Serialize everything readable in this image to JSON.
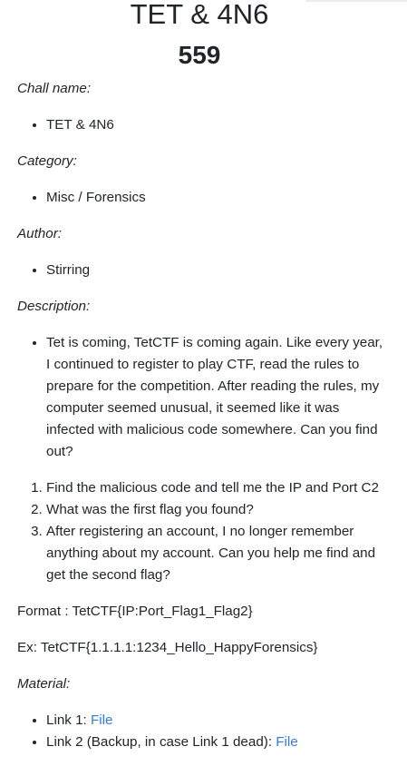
{
  "challenge": {
    "title": "TET & 4N6",
    "points": "559"
  },
  "sections": {
    "chall_name_label": "Chall name:",
    "chall_name_value": "TET & 4N6",
    "category_label": "Category:",
    "category_value": "Misc / Forensics",
    "author_label": "Author:",
    "author_value": "Stirring",
    "description_label": "Description:",
    "description_text": "Tet is coming, TetCTF is coming again. Like every year, I continued to register to play CTF, read the rules to prepare for the competition. After reading the rules, my computer seemed unusual, it seemed like it was infected with malicious code somewhere. Can you find out?",
    "questions": [
      "Find the malicious code and tell me the IP and Port C2",
      "What was the first flag you found?",
      "After registering an account, I no longer remember anything about my account. Can you help me find and get the second flag?"
    ],
    "format_text": "Format : TetCTF{IP:Port_Flag1_Flag2}",
    "example_text": "Ex: TetCTF{1.1.1.1:1234_Hello_HappyForensics}",
    "material_label": "Material:",
    "links": [
      {
        "prefix": "Link 1: ",
        "link_text": "File"
      },
      {
        "prefix": "Link 2 (Backup, in case Link 1 dead): ",
        "link_text": "File"
      }
    ]
  },
  "colors": {
    "text": "#212529",
    "link": "#3a7bd5"
  }
}
